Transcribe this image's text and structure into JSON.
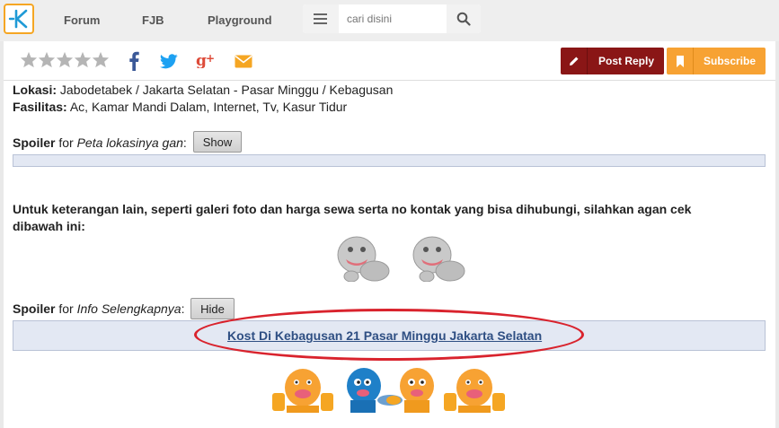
{
  "nav": {
    "logo": "K",
    "links": [
      "Forum",
      "FJB",
      "Playground"
    ],
    "search_placeholder": "cari disini"
  },
  "toolbar": {
    "post_reply": "Post Reply",
    "subscribe": "Subscribe",
    "rating_stars": 5,
    "rating_value": 0
  },
  "post": {
    "lokasi_label": "Lokasi:",
    "lokasi_value": "Jabodetabek / Jakarta Selatan - Pasar Minggu / Kebagusan",
    "fasilitas_label": "Fasilitas:",
    "fasilitas_value": "Ac, Kamar Mandi Dalam, Internet, Tv, Kasur Tidur",
    "spoiler1": {
      "label": "Spoiler",
      "for": "for",
      "title": "Peta lokasinya gan",
      "colon": ":",
      "button": "Show"
    },
    "paragraph": "Untuk keterangan lain, seperti galeri foto dan harga sewa serta no kontak yang bisa dihubungi, silahkan agan cek dibawah ini:",
    "spoiler2": {
      "label": "Spoiler",
      "for": "for",
      "title": "Info Selengkapnya",
      "colon": ":",
      "button": "Hide"
    },
    "link_text": "Kost Di Kebagusan 21 Pasar Minggu Jakarta Selatan"
  },
  "colors": {
    "brand_orange": "#f5a623",
    "brand_blue": "#1f9ad6",
    "post_reply_bg": "#8a1616",
    "subscribe_bg": "#f7a233",
    "spoiler_bg": "#e3e8f3",
    "highlight_ellipse": "#d9232d",
    "link": "#2f4f83"
  }
}
